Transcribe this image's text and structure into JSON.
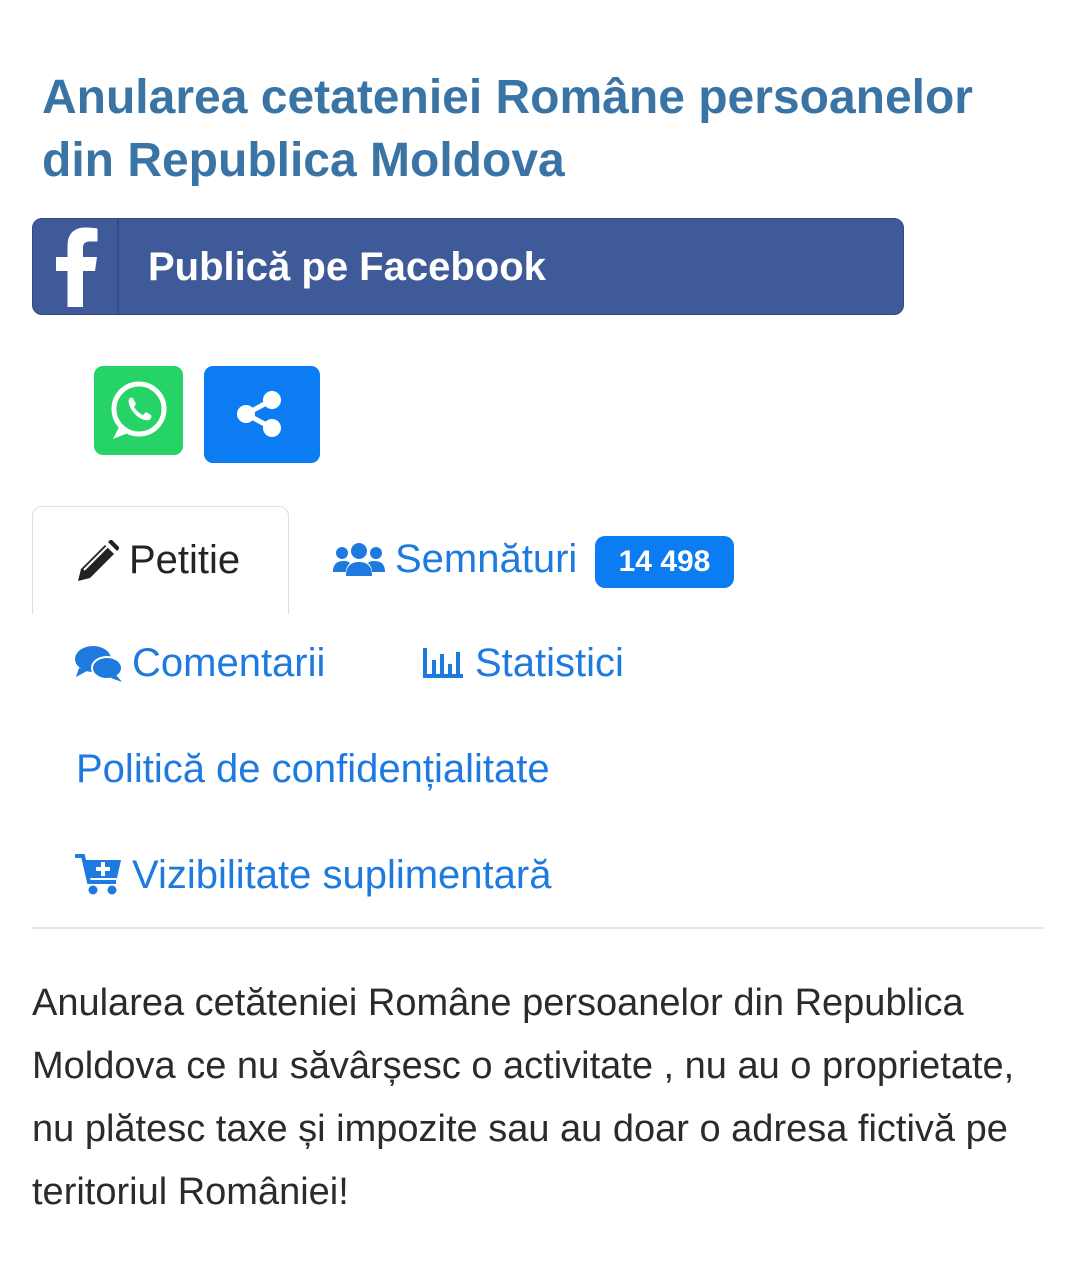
{
  "petition": {
    "title": "Anularea cetateniei Române persoanelor din Republica Moldova",
    "description": "Anularea cetăteniei Române persoanelor din Republica Moldova ce nu săvârșesc o activitate , nu au o proprietate, nu plătesc taxe și impozite sau au doar o adresa fictivă pe teritoriul României!"
  },
  "share": {
    "facebook_label": "Publică pe Facebook",
    "facebook_icon": "facebook-icon",
    "whatsapp_icon": "whatsapp-icon",
    "share_icon": "share-icon"
  },
  "tabs": {
    "petition": {
      "label": "Petitie",
      "icon": "pencil-icon",
      "active": true
    },
    "signatures": {
      "label": "Semnături",
      "icon": "users-icon",
      "count": "14 498"
    },
    "comments": {
      "label": "Comentarii",
      "icon": "comments-icon"
    },
    "statistics": {
      "label": "Statistici",
      "icon": "bar-chart-icon"
    },
    "privacy": {
      "label": "Politică de confidențialitate"
    },
    "visibility": {
      "label": "Vizibilitate suplimentară",
      "icon": "cart-plus-icon"
    }
  },
  "colors": {
    "title": "#3a74a4",
    "facebook": "#3e5a99",
    "whatsapp": "#25d366",
    "primary": "#0b7cf2",
    "link": "#1f7ae0"
  }
}
